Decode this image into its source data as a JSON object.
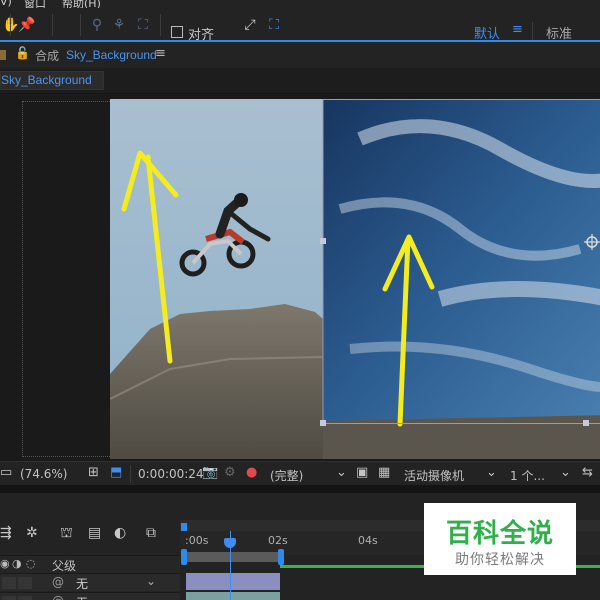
{
  "menu": {
    "items": [
      "V)",
      "窗口",
      "帮助(H)"
    ]
  },
  "toolbar": {
    "snap_label": "对齐",
    "workspace_default": "默认",
    "workspace_menu": "≡",
    "workspace_standard": "标准"
  },
  "comp_panel": {
    "label": "合成",
    "comp_name": "Sky_Background",
    "menu": "≡",
    "tab_name": "Sky_Background"
  },
  "viewer_controls": {
    "zoom": "(74.6%)",
    "timecode": "0:00:00:24",
    "resolution": "(完整)",
    "camera": "活动摄像机",
    "views": "1 个..."
  },
  "timeline": {
    "ticks": [
      ":00s",
      "02s",
      "04s"
    ],
    "parent_header": "父级",
    "layers": [
      {
        "parent": "无"
      },
      {
        "parent": "无"
      }
    ]
  },
  "watermark": {
    "title": "百科全说",
    "subtitle": "助你轻松解决"
  },
  "colors": {
    "accent_blue": "#2d8ceb",
    "annotation_yellow": "#f4ec1e",
    "watermark_green": "#2fb14a",
    "layer_bar": "#8a8fbd",
    "work_area_green": "#3bb34a"
  }
}
